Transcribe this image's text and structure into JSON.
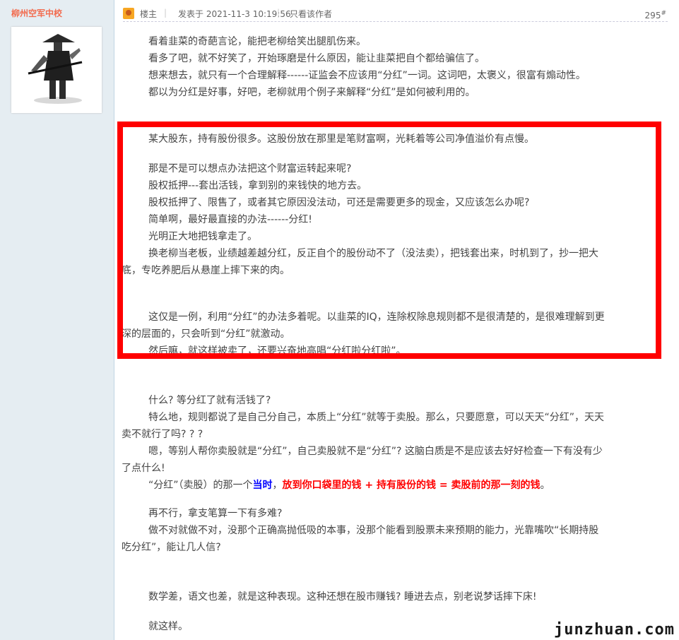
{
  "user": {
    "name": "柳州空军中校",
    "avatar_icon": "ninja-swordsman-avatar"
  },
  "post_header": {
    "op_label": "楼主",
    "posted_at": "发表于 2021-11-3 10:19:56",
    "only_author": "只看该作者",
    "floor": "295",
    "floor_mark": "#"
  },
  "body": {
    "p1": "看着韭菜的奇葩言论，能把老柳给笑出腿肌伤来。",
    "p2": "看多了吧，就不好笑了，开始琢磨是什么原因，能让韭菜把自个都给骗信了。",
    "p3": "想来想去，就只有一个合理解释------证监会不应该用“分红”一词。这词吧，太褒义，很富有煽动性。",
    "p4": "都以为分红是好事，好吧，老柳就用个例子来解释“分红”是如何被利用的。",
    "p5": "某大股东，持有股份很多。这股份放在那里是笔财富啊，光耗着等公司净值溢价有点慢。",
    "p6": "那是不是可以想点办法把这个财富运转起来呢?",
    "p7": "股权抵押---套出活钱，拿到别的来钱快的地方去。",
    "p8": "股权抵押了、限售了，或者其它原因没法动，可还是需要更多的现金，又应该怎么办呢?",
    "p9": "简单啊，最好最直接的办法------分红!",
    "p10": "光明正大地把钱拿走了。",
    "p11a": "换老柳当老板，业绩越差越分红，反正自个的股份动不了（没法卖），把钱套出来，时机到了，抄一把大",
    "p11b": "底，专吃养肥后从悬崖上摔下来的肉。",
    "p12a": "这仅是一例，利用“分红”的办法多着呢。以韭菜的IQ，连除权除息规则都不是很清楚的，是很难理解到更",
    "p12b": "深的层面的，只会听到“分红”就激动。",
    "p13": "然后嘛，就这样被卖了，还要兴奋地高唱“分红啦分红啦”。",
    "p14": "什么? 等分红了就有活钱了?",
    "p15a": "特么地，规则都说了是自己分自己，本质上“分红”就等于卖股。那么，只要愿意，可以天天“分红”，天天",
    "p15b": "卖不就行了吗? ? ?",
    "p16a": "嗯，等别人帮你卖股就是“分红”，自己卖股就不是“分红”? 这脑白质是不是应该去好好检查一下有没有少",
    "p16b": "了点什么!",
    "p17_pre": "“分红”（卖股）的那一个",
    "p17_blue": "当时",
    "p17_comma": "，",
    "p17_red": "放到你口袋里的钱 + 持有股份的钱 = 卖股前的那一刻的钱",
    "p17_end": "。",
    "p18": "再不行，拿支笔算一下有多难?",
    "p19a": "做不对就做不对，没那个正确高抛低吸的本事，没那个能看到股票未来预期的能力，光靠嘴吹“长期持股",
    "p19b": "吃分红”，能让几人信?",
    "p20": "数学差，语文也差，就是这种表现。这种还想在股市赚钱? 睡进去点，别老说梦话摔下床!",
    "p21": "就这样。"
  },
  "watermark": "junzhuan.com",
  "colors": {
    "highlight_border": "#ff0000",
    "emph_blue": "#0000ff",
    "emph_red": "#ff0000"
  }
}
